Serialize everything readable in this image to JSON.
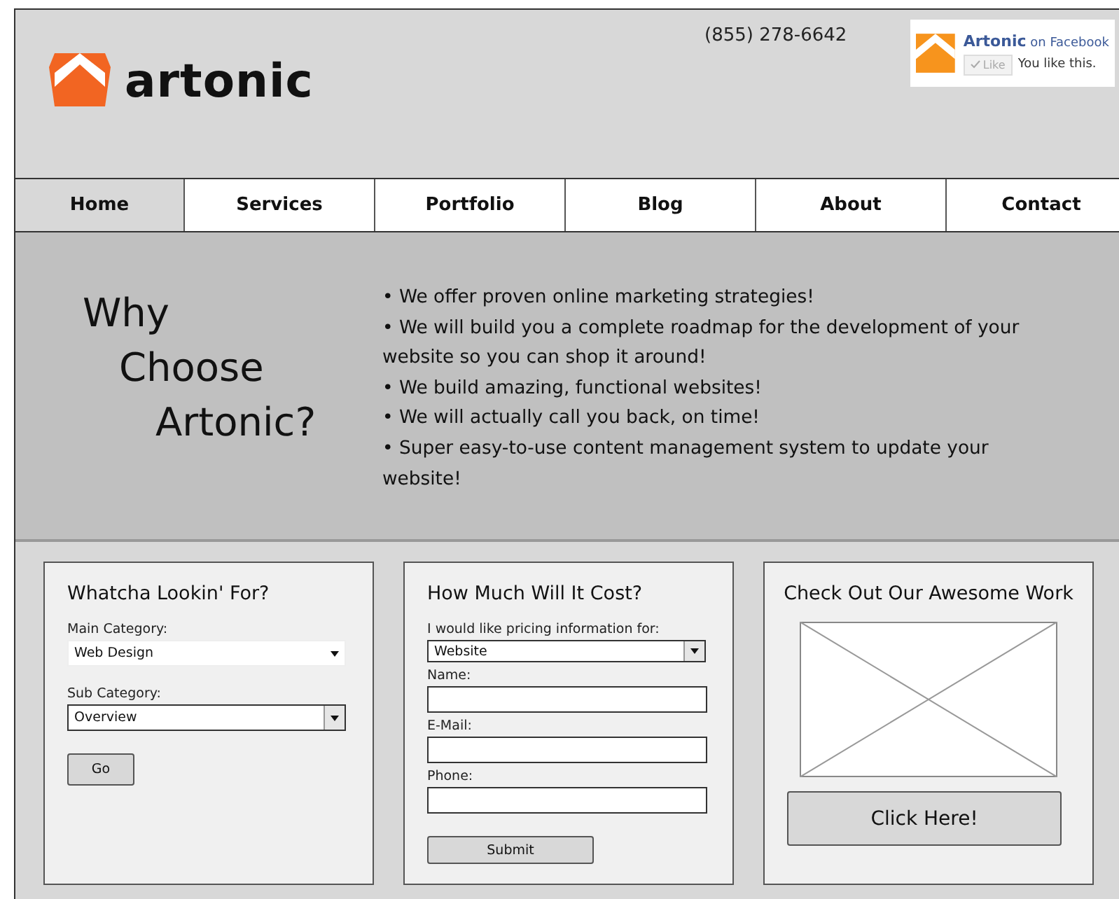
{
  "header": {
    "logo_text": "artonic",
    "phone": "(855) 278-6642",
    "facebook": {
      "page": "Artonic",
      "suffix": "on Facebook",
      "like_label": "Like",
      "liked": true,
      "status": "You like this."
    }
  },
  "nav": [
    {
      "label": "Home",
      "selected": true
    },
    {
      "label": "Services",
      "selected": false
    },
    {
      "label": "Portfolio",
      "selected": false
    },
    {
      "label": "Blog",
      "selected": false
    },
    {
      "label": "About",
      "selected": false
    },
    {
      "label": "Contact",
      "selected": false
    }
  ],
  "hero": {
    "heading_lines": [
      "Why",
      "Choose",
      "Artonic?"
    ],
    "bullets": [
      "• We offer proven online marketing strategies!",
      "• We will build you a complete roadmap for the development of your website so you can shop it around!",
      "• We build amazing, functional websites!",
      "• We will actually call you back, on time!",
      "• Super easy-to-use content management system to update your website!"
    ]
  },
  "cards": [
    {
      "title": "Whatcha Lookin' For?",
      "fields": [
        {
          "kind": "flat-select",
          "label": "Main Category:",
          "value": "Web Design"
        },
        {
          "kind": "select",
          "label": "Sub Category:",
          "value": "Overview"
        }
      ],
      "button": "Go"
    },
    {
      "title": "How Much Will It Cost?",
      "fields": [
        {
          "kind": "select",
          "label": "I would like pricing information for:",
          "value": "Website"
        },
        {
          "kind": "text",
          "label": "Name:"
        },
        {
          "kind": "text",
          "label": "E-Mail:"
        },
        {
          "kind": "text",
          "label": "Phone:"
        }
      ],
      "button": "Submit"
    },
    {
      "title": "Check Out Our Awesome Work",
      "image": {
        "kind": "placeholder"
      },
      "button": "Click Here!"
    }
  ]
}
